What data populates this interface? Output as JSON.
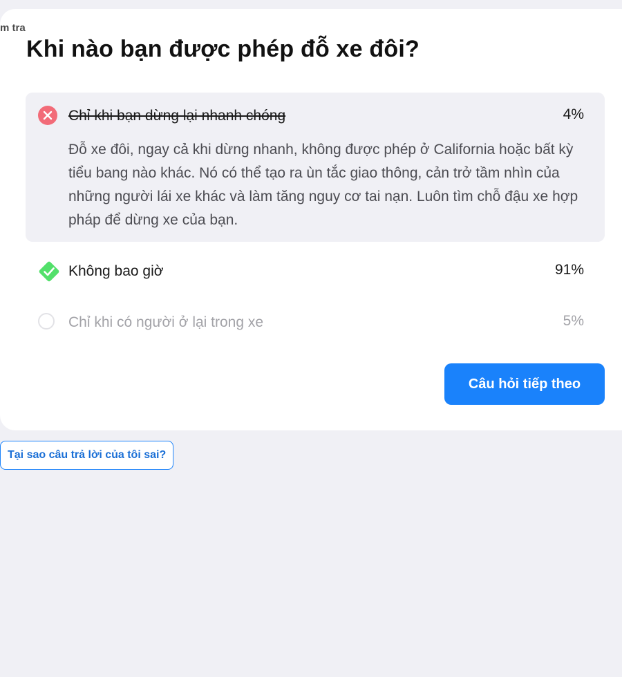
{
  "breadcrumb": "m tra",
  "question": "Khi nào bạn được phép đỗ xe đôi?",
  "answers": [
    {
      "label": "Chỉ khi bạn dừng lại nhanh chóng",
      "percent": "4%",
      "state": "selected-wrong",
      "icon": "wrong-x-icon",
      "explanation": "Đỗ xe đôi, ngay cả khi dừng nhanh, không được phép ở California hoặc bất kỳ tiểu bang nào khác. Nó có thể tạo ra ùn tắc giao thông, cản trở tầm nhìn của những người lái xe khác và làm tăng nguy cơ tai nạn. Luôn tìm chỗ đậu xe hợp pháp để dừng xe của bạn."
    },
    {
      "label": "Không bao giờ",
      "percent": "91%",
      "state": "correct",
      "icon": "check-diamond-icon"
    },
    {
      "label": "Chỉ khi có người ở lại trong xe",
      "percent": "5%",
      "state": "unselected",
      "icon": "empty-radio-icon"
    }
  ],
  "next_button": "Câu hỏi tiếp theo",
  "why_button": "Tại sao câu trả lời của tôi sai?",
  "colors": {
    "accent": "#1a82fb",
    "wrong": "#f26b78",
    "correct": "#52e06a",
    "page_bg": "#f0f0f5"
  }
}
